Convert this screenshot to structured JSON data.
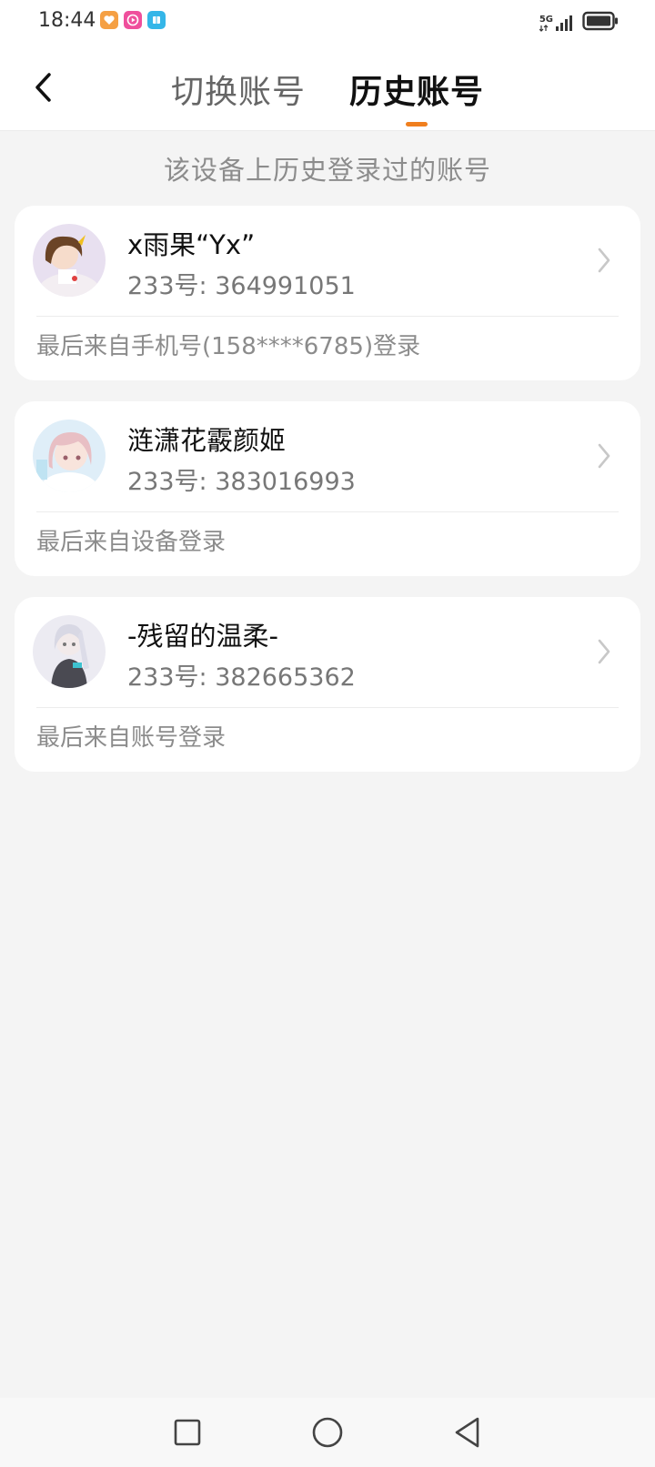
{
  "status_bar": {
    "time": "18:44",
    "network": "5G",
    "app_icons": [
      "heart-app-icon",
      "video-app-icon",
      "book-app-icon"
    ]
  },
  "header": {
    "tabs": [
      {
        "label": "切换账号",
        "active": false
      },
      {
        "label": "历史账号",
        "active": true
      }
    ],
    "accent_color": "#f07f1e"
  },
  "subtitle": "该设备上历史登录过的账号",
  "accounts": [
    {
      "nickname": "x雨果“Yx”",
      "uid_label": "233号: 364991051",
      "login_source": "最后来自手机号(158****6785)登录"
    },
    {
      "nickname": "涟潇花霰颜姬",
      "uid_label": "233号: 383016993",
      "login_source": "最后来自设备登录"
    },
    {
      "nickname": "-残留的温柔-",
      "uid_label": "233号: 382665362",
      "login_source": "最后来自账号登录"
    }
  ]
}
